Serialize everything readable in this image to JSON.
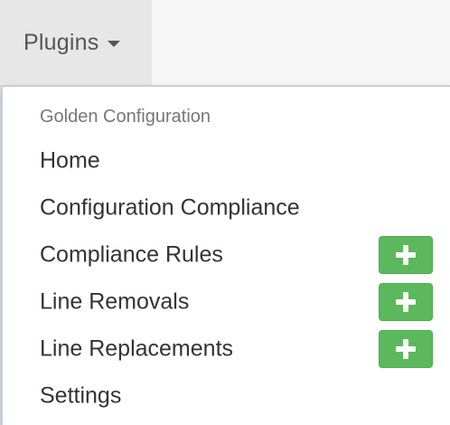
{
  "nav": {
    "plugins_label": "Plugins",
    "caret_icon": "caret-down-icon"
  },
  "dropdown": {
    "header": "Golden Configuration",
    "items": [
      {
        "label": "Home",
        "has_add": false
      },
      {
        "label": "Configuration Compliance",
        "has_add": false
      },
      {
        "label": "Compliance Rules",
        "has_add": true,
        "add_icon": "plus-icon"
      },
      {
        "label": "Line Removals",
        "has_add": true,
        "add_icon": "plus-icon"
      },
      {
        "label": "Line Replacements",
        "has_add": true,
        "add_icon": "plus-icon"
      },
      {
        "label": "Settings",
        "has_add": false
      }
    ]
  },
  "colors": {
    "add_button": "#5cb85c",
    "menu_text": "#333333",
    "header_text": "#777777",
    "nav_active_bg": "#e7e7e7"
  }
}
